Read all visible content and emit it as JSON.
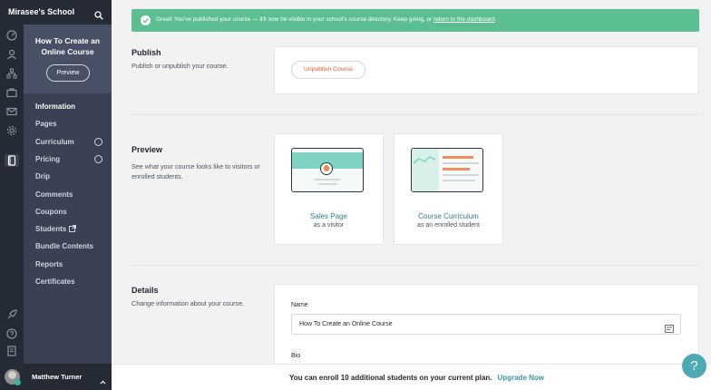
{
  "school": {
    "name": "Mirasee's School",
    "search_icon": "search-icon"
  },
  "course": {
    "title": "How To Create an Online Course",
    "preview_label": "Preview"
  },
  "nav": {
    "information": "Information",
    "pages": "Pages",
    "curriculum": "Curriculum",
    "pricing": "Pricing",
    "drip": "Drip",
    "comments": "Comments",
    "coupons": "Coupons",
    "students": "Students",
    "bundle_contents": "Bundle Contents",
    "reports": "Reports",
    "certificates": "Certificates"
  },
  "user": {
    "name": "Matthew Turner",
    "badge": "1"
  },
  "banner": {
    "message": "Great! You've published your course — it'll now be visible in your school's course directory. Keep going, or ",
    "link": "return to the dashboard",
    "end": "."
  },
  "publish": {
    "title": "Publish",
    "desc": "Publish or unpublish your course.",
    "button": "Unpublish Course"
  },
  "preview": {
    "title": "Preview",
    "desc": "See what your course looks like to visitors or enrolled students.",
    "cards": [
      {
        "link": "Sales Page",
        "sub": "as a visitor"
      },
      {
        "link": "Course Curriculum",
        "sub": "as an enrolled student"
      }
    ]
  },
  "details": {
    "title": "Details",
    "desc": "Change information about your course.",
    "name_label": "Name",
    "name_value": "How To Create an Online Course",
    "bio_label": "Bio"
  },
  "enroll": {
    "text": "You can enroll 10 additional students on your current plan.",
    "link": "Upgrade Now"
  },
  "help": {
    "label": "?"
  },
  "colors": {
    "accent": "#4da9b3",
    "success": "#5bbf92",
    "danger": "#e05a3c",
    "sidebar": "#3a4153"
  }
}
